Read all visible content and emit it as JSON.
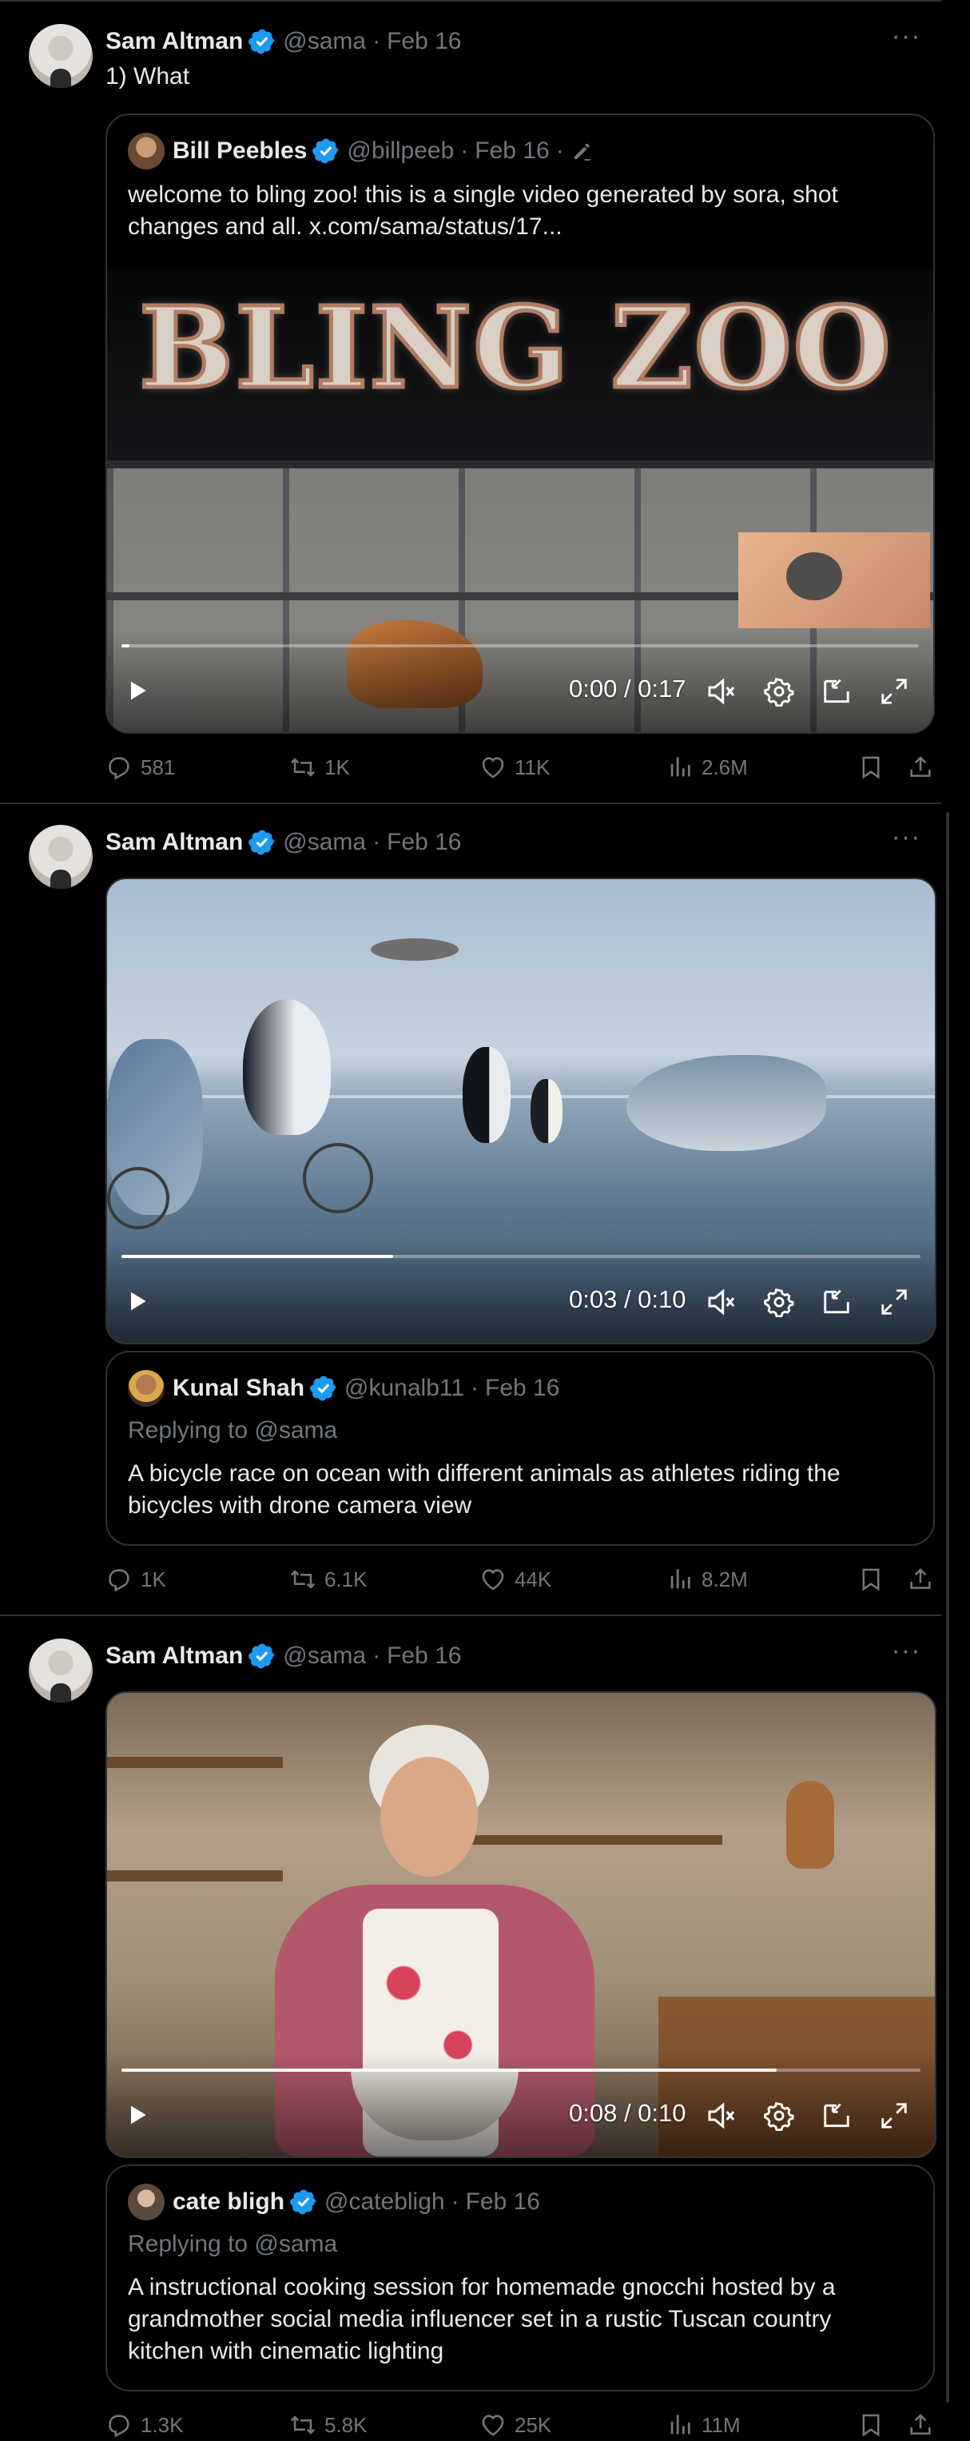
{
  "tweets": [
    {
      "author_name": "Sam Altman",
      "author_handle": "@sama",
      "separator": "·",
      "date": "Feb 16",
      "text": "1) What",
      "more_icon": "more-horizontal-icon",
      "quote": {
        "author_name": "Bill Peebles",
        "author_handle": "@billpeeb",
        "date": "Feb 16",
        "separator": "·",
        "edited_icon": "pencil-icon",
        "text_line1": "welcome to bling zoo! this is a single video generated by sora, shot",
        "text_line2": "changes and all.  x.com/sama/status/17..."
      },
      "video": {
        "sign_text": "BLING ZOO",
        "time": "0:00 / 0:17",
        "progress": 0.01
      },
      "stats": {
        "replies": "581",
        "reposts": "1K",
        "likes": "11K",
        "views": "2.6M"
      }
    },
    {
      "author_name": "Sam Altman",
      "author_handle": "@sama",
      "separator": "·",
      "date": "Feb 16",
      "video": {
        "time": "0:03 / 0:10",
        "progress": 0.34
      },
      "quote": {
        "author_name": "Kunal Shah",
        "author_handle": "@kunalb11",
        "date": "Feb 16",
        "separator": "·",
        "replying_to": "Replying to @sama",
        "text_line1": "A bicycle race on ocean with different animals as athletes riding the",
        "text_line2": "bicycles with drone camera view"
      },
      "stats": {
        "replies": "1K",
        "reposts": "6.1K",
        "likes": "44K",
        "views": "8.2M"
      }
    },
    {
      "author_name": "Sam Altman",
      "author_handle": "@sama",
      "separator": "·",
      "date": "Feb 16",
      "video": {
        "time": "0:08 / 0:10",
        "progress": 0.82
      },
      "quote": {
        "author_name": "cate bligh",
        "author_handle": "@catebligh",
        "date": "Feb 16",
        "separator": "·",
        "replying_to": "Replying to @sama",
        "text_line1": "A instructional cooking session for homemade gnocchi hosted by a",
        "text_line2": "grandmother social media influencer set in a rustic Tuscan country",
        "text_line3": "kitchen with cinematic lighting"
      },
      "stats": {
        "replies": "1.3K",
        "reposts": "5.8K",
        "likes": "25K",
        "views": "11M"
      }
    }
  ],
  "colors": {
    "background": "#000000",
    "text_primary": "#e7e9ea",
    "text_secondary": "#71767b",
    "border": "#2f3336",
    "verified_blue": "#1d9bf0"
  },
  "icons": {
    "verified": "verified-badge-icon",
    "reply": "reply-icon",
    "repost": "repost-icon",
    "like": "heart-icon",
    "views": "views-icon",
    "bookmark": "bookmark-icon",
    "share": "share-icon",
    "play": "play-icon",
    "mute": "muted-speaker-icon",
    "settings": "gear-icon",
    "pip": "picture-in-picture-icon",
    "fullscreen": "fullscreen-icon"
  }
}
